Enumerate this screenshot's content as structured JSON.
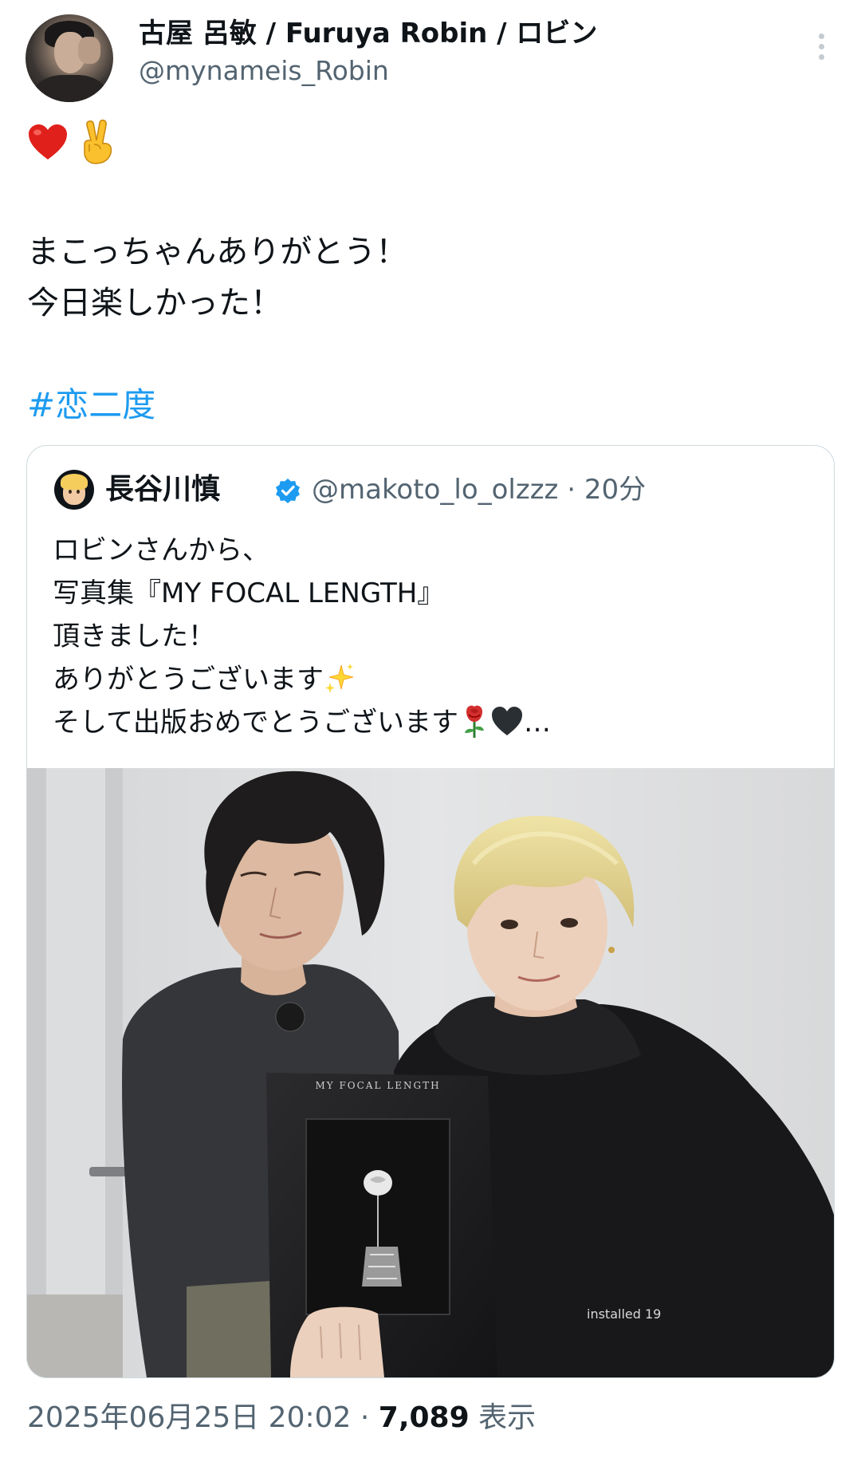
{
  "author": {
    "display_name": "古屋 呂敏 / Furuya Robin / ロビン",
    "handle": "@mynameis_Robin"
  },
  "tweet": {
    "emoji_line": [
      "red-heart",
      "victory-hand"
    ],
    "lines": [
      "まこっちゃんありがとう！",
      "今日楽しかった！"
    ],
    "hashtag": "#恋二度"
  },
  "quote": {
    "display_name": "長谷川慎",
    "handle": "@makoto_lo_olzzz",
    "time": "· 20分",
    "lines": [
      "ロビンさんから、",
      "写真集『MY FOCAL LENGTH』",
      "頂きました！",
      "ありがとうございます",
      "そして出版おめでとうございます"
    ],
    "line4_emoji": "sparkles",
    "line5_emojis": [
      "rose",
      "black-heart"
    ],
    "line5_suffix": "…",
    "photo": {
      "book_title": "MY FOCAL LENGTH",
      "hoodie_print": "installed 19"
    }
  },
  "footer": {
    "date": "2025年06月25日 20:02",
    "separator": " · ",
    "views_count": "7,089",
    "views_label": " 表示"
  },
  "colors": {
    "link": "#1d9bf0",
    "secondary_text": "#536471",
    "border": "#cfd9de",
    "verified": "#1d9bf0"
  }
}
